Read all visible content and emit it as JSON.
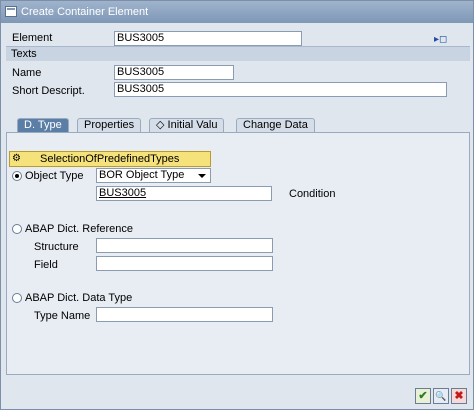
{
  "window": {
    "title": "Create Container Element"
  },
  "element": {
    "label": "Element",
    "value": "BUS3005"
  },
  "texts": {
    "header": "Texts",
    "name_label": "Name",
    "name_value": "BUS3005",
    "short_label": "Short Descript.",
    "short_value": "BUS3005"
  },
  "tabs": [
    {
      "label": "D. Type",
      "active": true
    },
    {
      "label": "Properties"
    },
    {
      "label": "Initial Valu"
    },
    {
      "label": "Change Data"
    }
  ],
  "selection_button": {
    "label": "SelectionOfPredefinedTypes"
  },
  "object_type": {
    "radio_label": "Object Type",
    "selected": "BOR Object Type",
    "value": "BUS3005",
    "condition_label": "Condition"
  },
  "abap_ref": {
    "radio_label": "ABAP Dict. Reference",
    "structure_label": "Structure",
    "structure_value": "",
    "field_label": "Field",
    "field_value": ""
  },
  "abap_type": {
    "radio_label": "ABAP Dict. Data Type",
    "typename_label": "Type Name",
    "typename_value": ""
  },
  "buttons": {
    "ok": "✔",
    "view": "🔍",
    "cancel": "✖"
  }
}
